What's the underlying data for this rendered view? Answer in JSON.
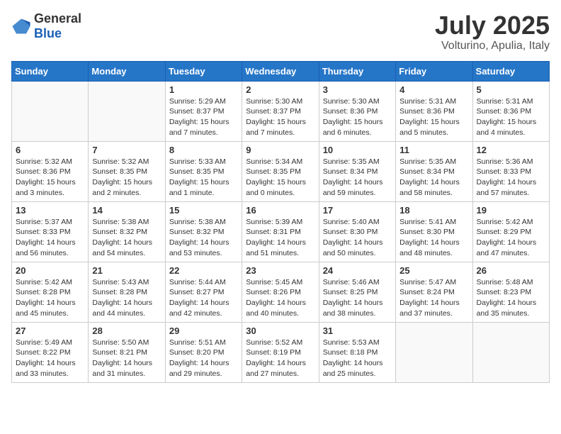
{
  "header": {
    "logo_general": "General",
    "logo_blue": "Blue",
    "month": "July 2025",
    "location": "Volturino, Apulia, Italy"
  },
  "weekdays": [
    "Sunday",
    "Monday",
    "Tuesday",
    "Wednesday",
    "Thursday",
    "Friday",
    "Saturday"
  ],
  "weeks": [
    [
      {
        "day": "",
        "content": ""
      },
      {
        "day": "",
        "content": ""
      },
      {
        "day": "1",
        "content": "Sunrise: 5:29 AM\nSunset: 8:37 PM\nDaylight: 15 hours and 7 minutes."
      },
      {
        "day": "2",
        "content": "Sunrise: 5:30 AM\nSunset: 8:37 PM\nDaylight: 15 hours and 7 minutes."
      },
      {
        "day": "3",
        "content": "Sunrise: 5:30 AM\nSunset: 8:36 PM\nDaylight: 15 hours and 6 minutes."
      },
      {
        "day": "4",
        "content": "Sunrise: 5:31 AM\nSunset: 8:36 PM\nDaylight: 15 hours and 5 minutes."
      },
      {
        "day": "5",
        "content": "Sunrise: 5:31 AM\nSunset: 8:36 PM\nDaylight: 15 hours and 4 minutes."
      }
    ],
    [
      {
        "day": "6",
        "content": "Sunrise: 5:32 AM\nSunset: 8:36 PM\nDaylight: 15 hours and 3 minutes."
      },
      {
        "day": "7",
        "content": "Sunrise: 5:32 AM\nSunset: 8:35 PM\nDaylight: 15 hours and 2 minutes."
      },
      {
        "day": "8",
        "content": "Sunrise: 5:33 AM\nSunset: 8:35 PM\nDaylight: 15 hours and 1 minute."
      },
      {
        "day": "9",
        "content": "Sunrise: 5:34 AM\nSunset: 8:35 PM\nDaylight: 15 hours and 0 minutes."
      },
      {
        "day": "10",
        "content": "Sunrise: 5:35 AM\nSunset: 8:34 PM\nDaylight: 14 hours and 59 minutes."
      },
      {
        "day": "11",
        "content": "Sunrise: 5:35 AM\nSunset: 8:34 PM\nDaylight: 14 hours and 58 minutes."
      },
      {
        "day": "12",
        "content": "Sunrise: 5:36 AM\nSunset: 8:33 PM\nDaylight: 14 hours and 57 minutes."
      }
    ],
    [
      {
        "day": "13",
        "content": "Sunrise: 5:37 AM\nSunset: 8:33 PM\nDaylight: 14 hours and 56 minutes."
      },
      {
        "day": "14",
        "content": "Sunrise: 5:38 AM\nSunset: 8:32 PM\nDaylight: 14 hours and 54 minutes."
      },
      {
        "day": "15",
        "content": "Sunrise: 5:38 AM\nSunset: 8:32 PM\nDaylight: 14 hours and 53 minutes."
      },
      {
        "day": "16",
        "content": "Sunrise: 5:39 AM\nSunset: 8:31 PM\nDaylight: 14 hours and 51 minutes."
      },
      {
        "day": "17",
        "content": "Sunrise: 5:40 AM\nSunset: 8:30 PM\nDaylight: 14 hours and 50 minutes."
      },
      {
        "day": "18",
        "content": "Sunrise: 5:41 AM\nSunset: 8:30 PM\nDaylight: 14 hours and 48 minutes."
      },
      {
        "day": "19",
        "content": "Sunrise: 5:42 AM\nSunset: 8:29 PM\nDaylight: 14 hours and 47 minutes."
      }
    ],
    [
      {
        "day": "20",
        "content": "Sunrise: 5:42 AM\nSunset: 8:28 PM\nDaylight: 14 hours and 45 minutes."
      },
      {
        "day": "21",
        "content": "Sunrise: 5:43 AM\nSunset: 8:28 PM\nDaylight: 14 hours and 44 minutes."
      },
      {
        "day": "22",
        "content": "Sunrise: 5:44 AM\nSunset: 8:27 PM\nDaylight: 14 hours and 42 minutes."
      },
      {
        "day": "23",
        "content": "Sunrise: 5:45 AM\nSunset: 8:26 PM\nDaylight: 14 hours and 40 minutes."
      },
      {
        "day": "24",
        "content": "Sunrise: 5:46 AM\nSunset: 8:25 PM\nDaylight: 14 hours and 38 minutes."
      },
      {
        "day": "25",
        "content": "Sunrise: 5:47 AM\nSunset: 8:24 PM\nDaylight: 14 hours and 37 minutes."
      },
      {
        "day": "26",
        "content": "Sunrise: 5:48 AM\nSunset: 8:23 PM\nDaylight: 14 hours and 35 minutes."
      }
    ],
    [
      {
        "day": "27",
        "content": "Sunrise: 5:49 AM\nSunset: 8:22 PM\nDaylight: 14 hours and 33 minutes."
      },
      {
        "day": "28",
        "content": "Sunrise: 5:50 AM\nSunset: 8:21 PM\nDaylight: 14 hours and 31 minutes."
      },
      {
        "day": "29",
        "content": "Sunrise: 5:51 AM\nSunset: 8:20 PM\nDaylight: 14 hours and 29 minutes."
      },
      {
        "day": "30",
        "content": "Sunrise: 5:52 AM\nSunset: 8:19 PM\nDaylight: 14 hours and 27 minutes."
      },
      {
        "day": "31",
        "content": "Sunrise: 5:53 AM\nSunset: 8:18 PM\nDaylight: 14 hours and 25 minutes."
      },
      {
        "day": "",
        "content": ""
      },
      {
        "day": "",
        "content": ""
      }
    ]
  ]
}
